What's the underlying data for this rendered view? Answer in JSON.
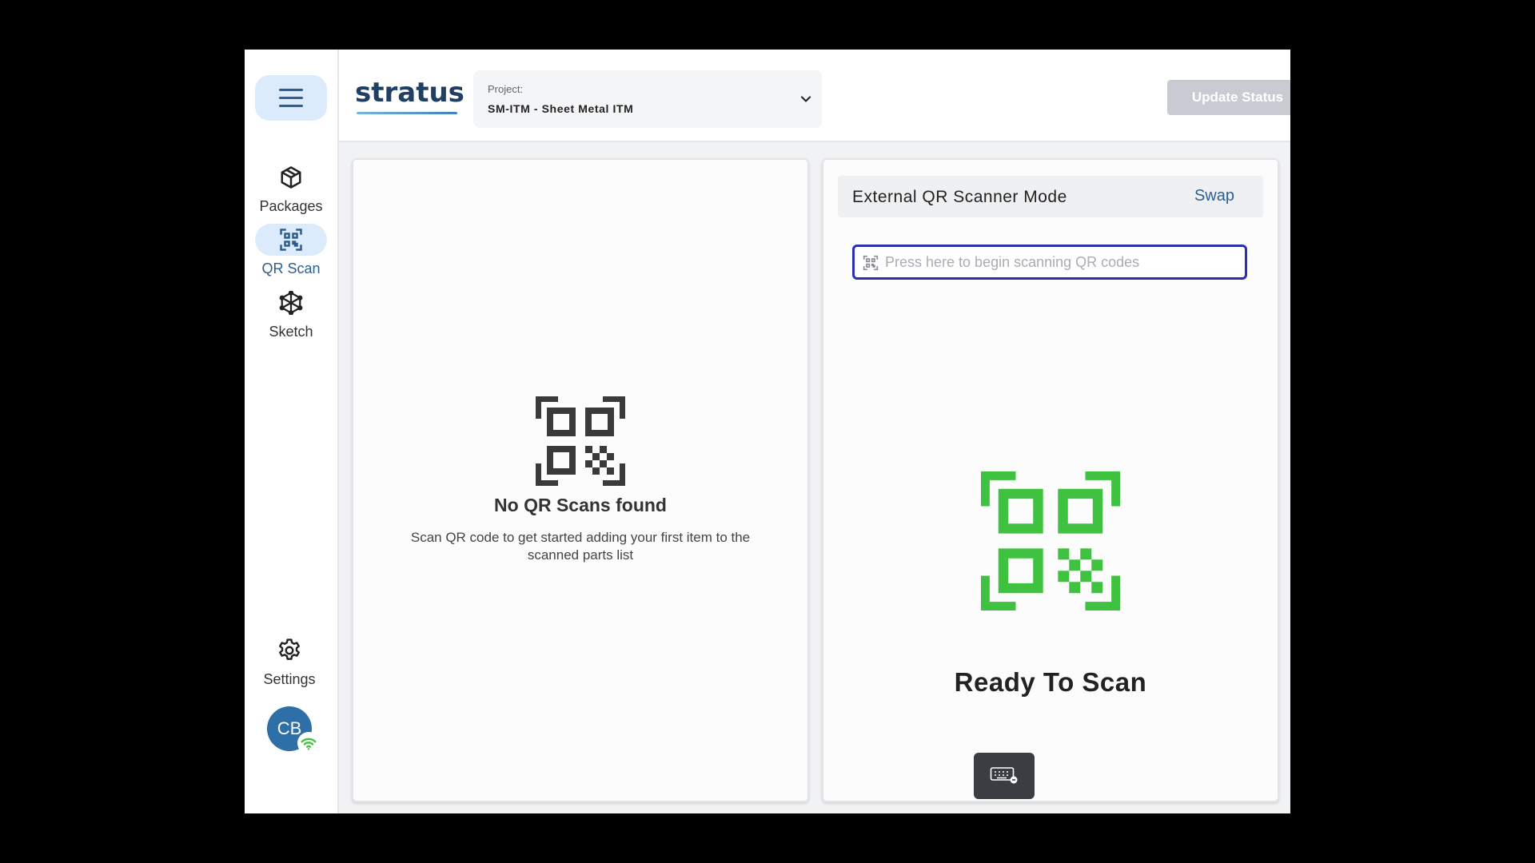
{
  "app": {
    "logo_text": "stratus",
    "colors": {
      "accent": "#2d5e8f",
      "ready": "#3fc23f",
      "input_focus": "#2b2fb8"
    }
  },
  "sidebar": {
    "menu_icon": "hamburger-icon",
    "items": [
      {
        "label": "Packages",
        "icon": "package-icon",
        "active": false
      },
      {
        "label": "QR Scan",
        "icon": "qr-scan-icon",
        "active": true
      },
      {
        "label": "Sketch",
        "icon": "sketch-icon",
        "active": false
      }
    ],
    "settings_label": "Settings",
    "avatar_initials": "CB"
  },
  "header": {
    "project_label": "Project:",
    "project_value": "SM-ITM - Sheet Metal ITM",
    "update_button": "Update Status"
  },
  "left_panel": {
    "empty_title": "No QR Scans found",
    "empty_desc": "Scan QR code to get started adding your first item to the scanned parts list"
  },
  "right_panel": {
    "mode_title": "External QR Scanner Mode",
    "swap_label": "Swap",
    "scan_placeholder": "Press here to begin scanning QR codes",
    "ready_text": "Ready To Scan"
  }
}
